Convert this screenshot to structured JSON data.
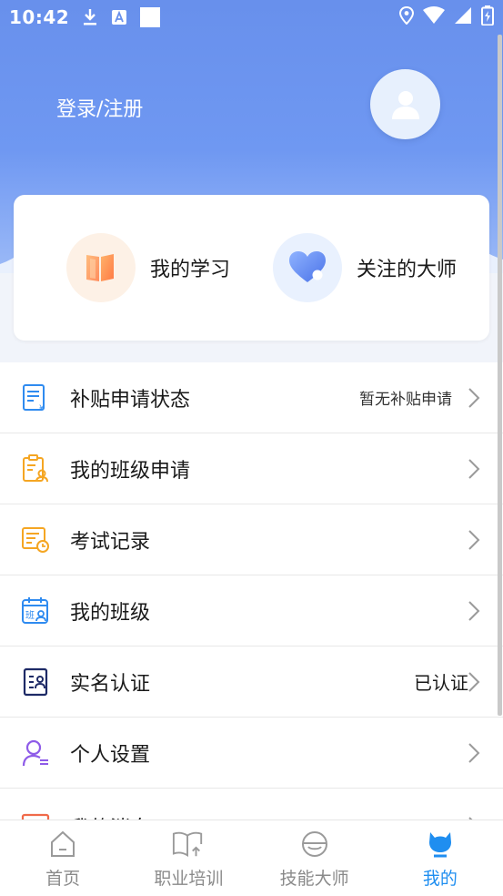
{
  "status_bar": {
    "time": "10:42",
    "icons": [
      "download-icon",
      "a-box-icon",
      "square-icon",
      "location-icon",
      "wifi-icon",
      "signal-icon",
      "battery-charging-icon"
    ]
  },
  "header": {
    "login_text": "登录/注册",
    "avatar_icon": "user-avatar-icon"
  },
  "quick_actions": [
    {
      "label": "我的学习",
      "icon": "book-icon"
    },
    {
      "label": "关注的大师",
      "icon": "heart-icon"
    }
  ],
  "menu": [
    {
      "label": "补贴申请状态",
      "value": "暂无补贴申请",
      "icon": "subsidy-document-icon"
    },
    {
      "label": "我的班级申请",
      "value": "",
      "icon": "class-application-icon"
    },
    {
      "label": "考试记录",
      "value": "",
      "icon": "exam-record-icon"
    },
    {
      "label": "我的班级",
      "value": "",
      "icon": "my-class-icon"
    },
    {
      "label": "实名认证",
      "value": "已认证",
      "icon": "id-card-icon"
    },
    {
      "label": "个人设置",
      "value": "",
      "icon": "person-settings-icon"
    },
    {
      "label": "我的消息",
      "value": "",
      "icon": "message-icon"
    }
  ],
  "tabs": [
    {
      "label": "首页",
      "icon": "home-icon",
      "active": false
    },
    {
      "label": "职业培训",
      "icon": "book-upload-icon",
      "active": false
    },
    {
      "label": "技能大师",
      "icon": "master-icon",
      "active": false
    },
    {
      "label": "我的",
      "icon": "profile-icon",
      "active": true
    }
  ],
  "colors": {
    "header_blue": "#6890ec",
    "tab_active": "#1f8ef0",
    "tab_inactive": "#8a8a8a"
  }
}
